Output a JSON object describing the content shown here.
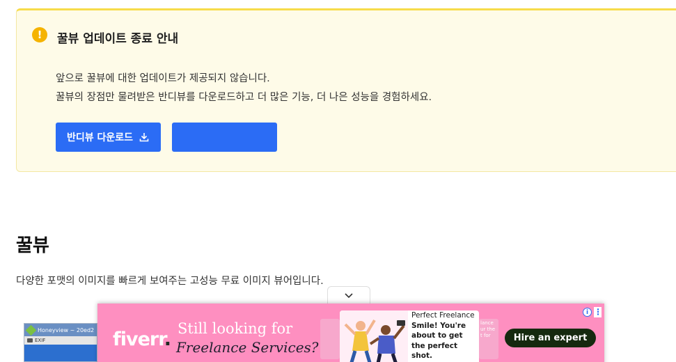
{
  "notice": {
    "title": "꿀뷰 업데이트 종료 안내",
    "line1": "앞으로 꿀뷰에 대한 업데이트가 제공되지 않습니다.",
    "line2": "꿀뷰의 장점만 물려받은 반디뷰를 다운로드하고 더 많은 기능, 더 나은 성능을 경험하세요.",
    "download_button": "반디뷰 다운로드",
    "icon": "exclamation-icon"
  },
  "page": {
    "title": "꿀뷰",
    "description": "다양한 포맷의 이미지를 빠르게 보여주는 고성능 무료 이미지 뷰어입니다."
  },
  "thumbnail": {
    "window_title": "Honeyview ~ 20ed2",
    "toolbar_label": "EXIF"
  },
  "ad": {
    "brand": "fiverr",
    "headline_1": "Still looking for",
    "headline_2": "Freelance Services?",
    "card_title": "Perfect Freelance",
    "card_text": "Smile! You're about to get the perfect shot.",
    "ghost_text": "lance ur the t for",
    "cta": "Hire an expert",
    "info_icon": "i"
  },
  "colors": {
    "primary_button": "#2b6cf5",
    "notice_bg": "#fefbe8",
    "notice_border": "#f7dc4a",
    "ad_bg": "#fe8fc0",
    "cta_bg": "#15290f"
  }
}
